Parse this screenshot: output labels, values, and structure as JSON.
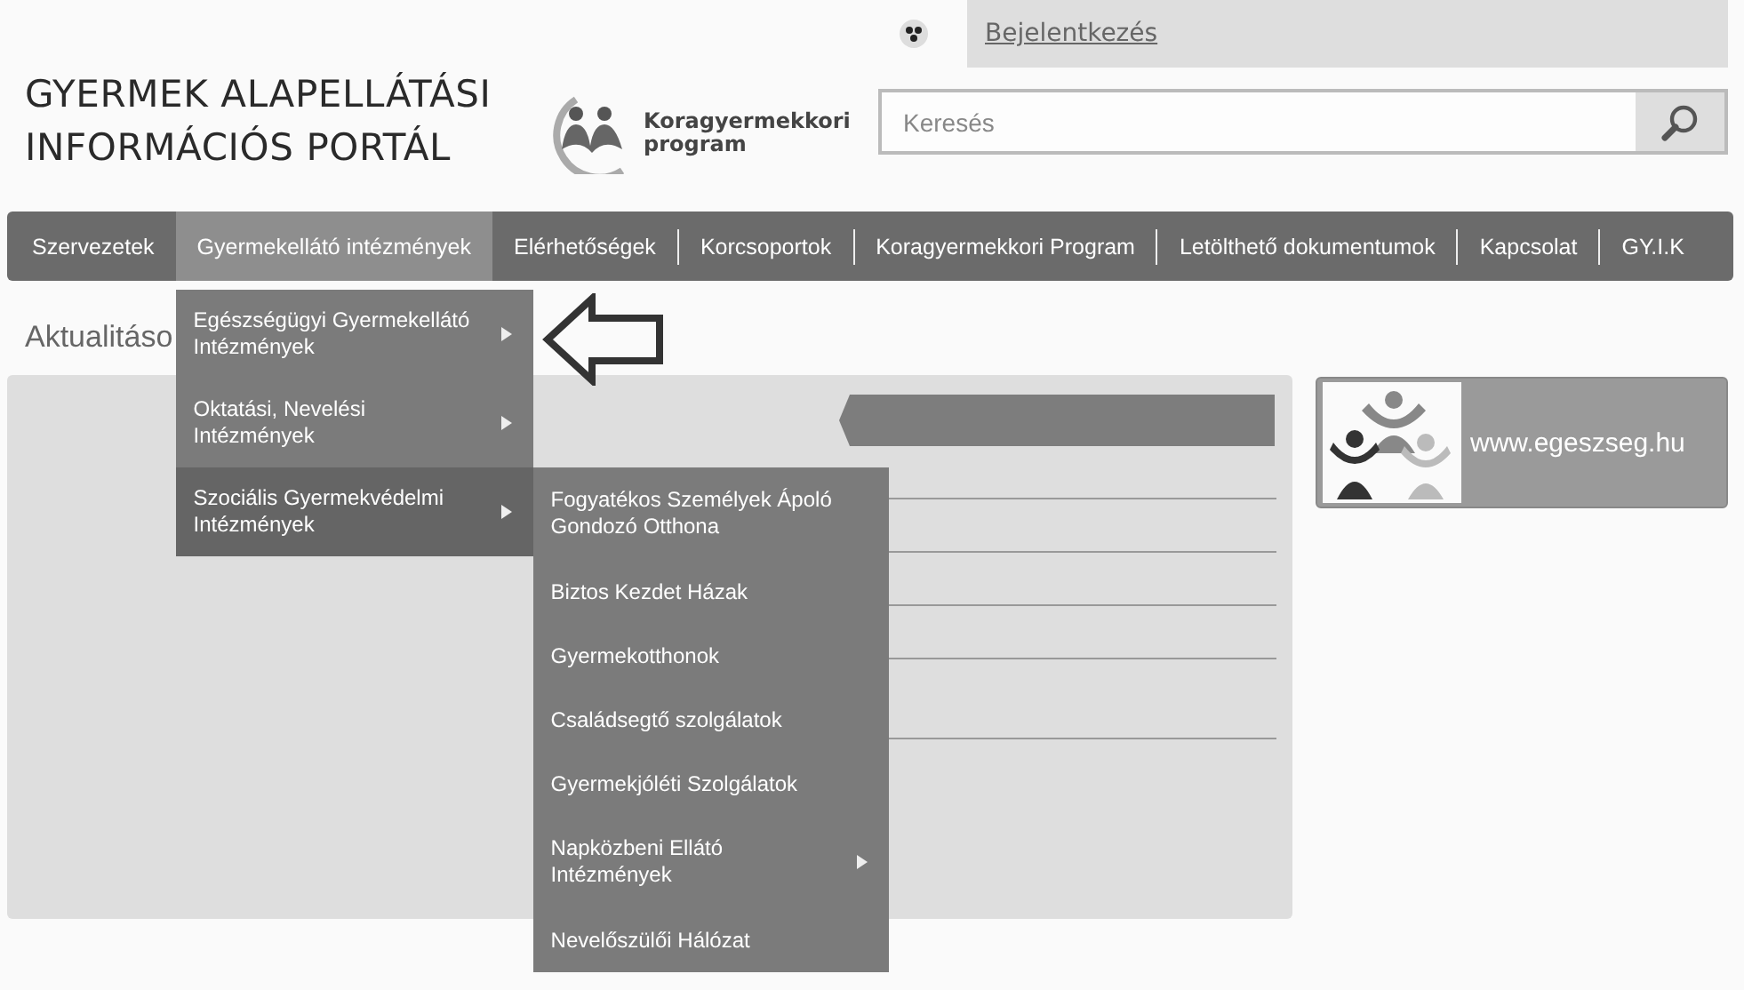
{
  "header": {
    "title_lines": [
      "GYERMEK ALAPELLÁTÁSI",
      "INFORMÁCIÓS PORTÁL"
    ],
    "logo_lines": [
      "Koragyermekkori",
      "program"
    ],
    "login_link": "Bejelentkezés",
    "search": {
      "placeholder": "Keresés"
    }
  },
  "nav": [
    {
      "label": "Szervezetek",
      "selected": false
    },
    {
      "label": "Gyermekellátó intézmények",
      "selected": true,
      "menu": [
        {
          "label": "Egészségügyi Gyermekellátó Intézmények",
          "has_submenu": true,
          "selected": false
        },
        {
          "label": "Oktatási, Nevelési Intézmények",
          "has_submenu": true,
          "selected": false
        },
        {
          "label": "Szociális Gyermekvédelmi Intézmények",
          "has_submenu": true,
          "selected": true,
          "submenu": [
            {
              "label": "Fogyatékos Személyek Ápoló Gondozó Otthona",
              "has_submenu": false
            },
            {
              "label": "Biztos Kezdet Házak",
              "has_submenu": false
            },
            {
              "label": "Gyermekotthonok",
              "has_submenu": false
            },
            {
              "label": "Családsegtő szolgálatok",
              "has_submenu": false
            },
            {
              "label": "Gyermekjóléti Szolgálatok",
              "has_submenu": false
            },
            {
              "label": "Napközbeni Ellátó Intézmények",
              "has_submenu": true
            },
            {
              "label": "Nevelőszülői Hálózat",
              "has_submenu": false
            }
          ]
        }
      ]
    },
    {
      "label": "Elérhetőségek",
      "selected": false
    },
    {
      "label": "Korcsoportok",
      "selected": false
    },
    {
      "label": "Koragyermekkori Program",
      "selected": false
    },
    {
      "label": "Letölthető dokumentumok",
      "selected": false
    },
    {
      "label": "Kapcsolat",
      "selected": false
    },
    {
      "label": "GY.I.K",
      "selected": false
    }
  ],
  "section_heading": "Aktualitáso",
  "banner": {
    "text": "www.egeszseg.hu"
  }
}
